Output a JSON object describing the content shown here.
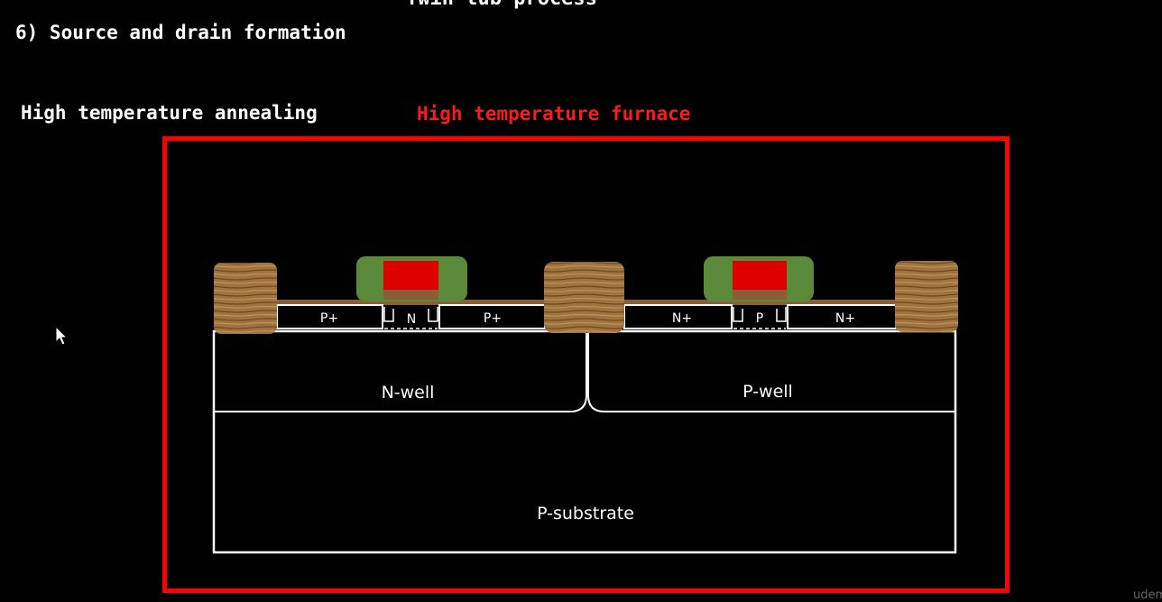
{
  "header": {
    "top_title": "Twin tub process",
    "step_heading": "6) Source and drain formation"
  },
  "process": {
    "step_label": "High temperature annealing",
    "equipment_label": "High temperature furnace"
  },
  "diagram": {
    "n_well_label": "N-well",
    "p_well_label": "P-well",
    "substrate_label": "P-substrate",
    "pmos": {
      "source_label": "P+",
      "channel_label": "N",
      "drain_label": "P+"
    },
    "nmos": {
      "source_label": "N+",
      "channel_label": "P",
      "drain_label": "N+"
    }
  },
  "colors": {
    "frame": "#ff0000",
    "equipment_text": "#ff1a1a",
    "spacer": "#5a8a3a",
    "gate": "#dd0000",
    "field_oxide": "#a0743f",
    "gate_oxide": "#8b5e34"
  },
  "watermark": "udem"
}
